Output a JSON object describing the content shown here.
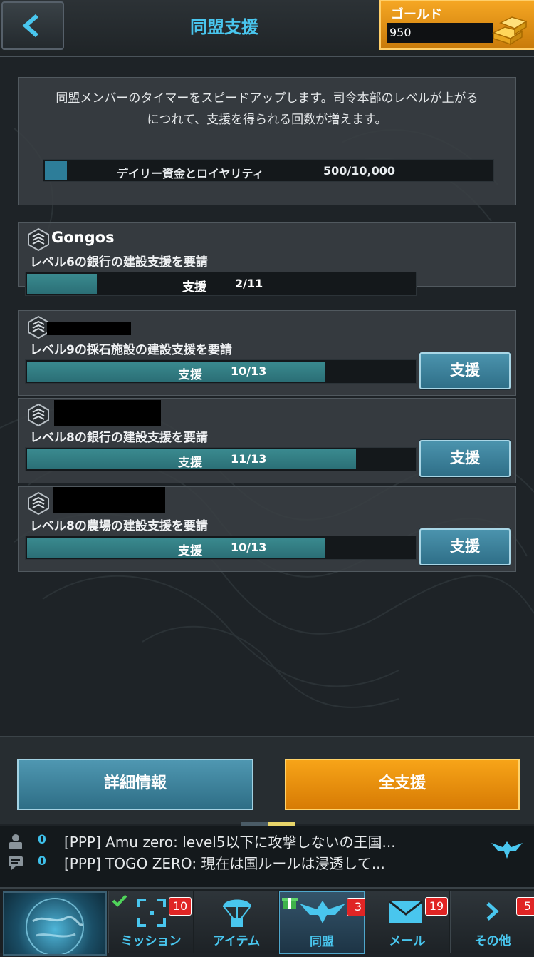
{
  "header": {
    "title": "同盟支援",
    "back_icon": "back-arrow-icon",
    "gold": {
      "label": "ゴールド",
      "value": "950",
      "icon": "gold-bars-icon"
    }
  },
  "info": {
    "description_line1": "同盟メンバーのタイマーをスピードアップします。司令本部のレベルが上がる",
    "description_line2": "につれて、支援を得られる回数が増えます。",
    "daily_label": "デイリー資金とロイヤリティ",
    "daily_value": "500/10,000",
    "daily_progress": 0.05
  },
  "requests": [
    {
      "name": "Gongos",
      "desc": "レベル6の銀行の建設支援を要請",
      "bar_label": "支援",
      "count": "2/11",
      "progress": 0.18,
      "has_button": false
    },
    {
      "name": "",
      "desc": "レベル9の採石施設の建設支援を要請",
      "bar_label": "支援",
      "count": "10/13",
      "progress": 0.77,
      "has_button": true,
      "button": "支援"
    },
    {
      "name": "",
      "desc": "レベル8の銀行の建設支援を要請",
      "bar_label": "支援",
      "count": "11/13",
      "progress": 0.85,
      "has_button": true,
      "button": "支援"
    },
    {
      "name": "",
      "desc": "レベル8の農場の建設支援を要請",
      "bar_label": "支援",
      "count": "10/13",
      "progress": 0.77,
      "has_button": true,
      "button": "支援"
    }
  ],
  "actions": {
    "detail": "詳細情報",
    "assist_all": "全支援"
  },
  "chat": {
    "rows": [
      {
        "icon": "player-icon",
        "count": "0",
        "text": "[PPP] Amu zero: level5以下に攻撃しないの王国..."
      },
      {
        "icon": "chat-bubble-icon",
        "count": "0",
        "text": "[PPP] TOGO  ZERO: 現在は国ルールは浸透して..."
      }
    ],
    "emblem": "alliance-emblem-icon"
  },
  "nav": {
    "items": [
      {
        "label": "ミッション",
        "badge": "10",
        "icon": "crosshair-icon"
      },
      {
        "label": "アイテム",
        "badge": "",
        "icon": "parachute-icon"
      },
      {
        "label": "同盟",
        "badge": "3",
        "icon": "alliance-eagle-icon"
      },
      {
        "label": "メール",
        "badge": "19",
        "icon": "mail-icon"
      },
      {
        "label": "その他",
        "badge": "5",
        "icon": "chevron-right-icon"
      }
    ]
  },
  "colors": {
    "accent": "#49c6ee",
    "gold": "#f5a623",
    "bar_fill": "#3a8a8f",
    "badge": "#e02525"
  }
}
